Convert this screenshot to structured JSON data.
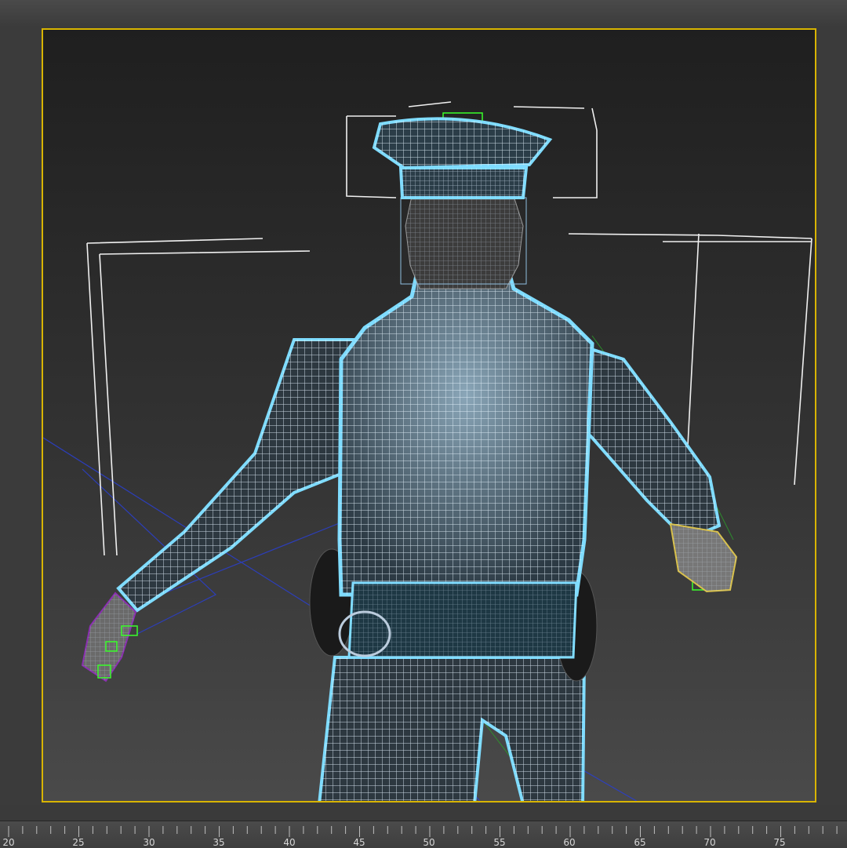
{
  "app": {
    "accent_color": "#d8b400",
    "selection_color": "#7fdcff"
  },
  "viewport": {
    "mode": "wireframe",
    "object": "police officer character model",
    "view": "back"
  },
  "timeline": {
    "ticks": [
      "20",
      "25",
      "30",
      "35",
      "40",
      "45",
      "50",
      "55",
      "60",
      "65",
      "70",
      "75"
    ]
  }
}
